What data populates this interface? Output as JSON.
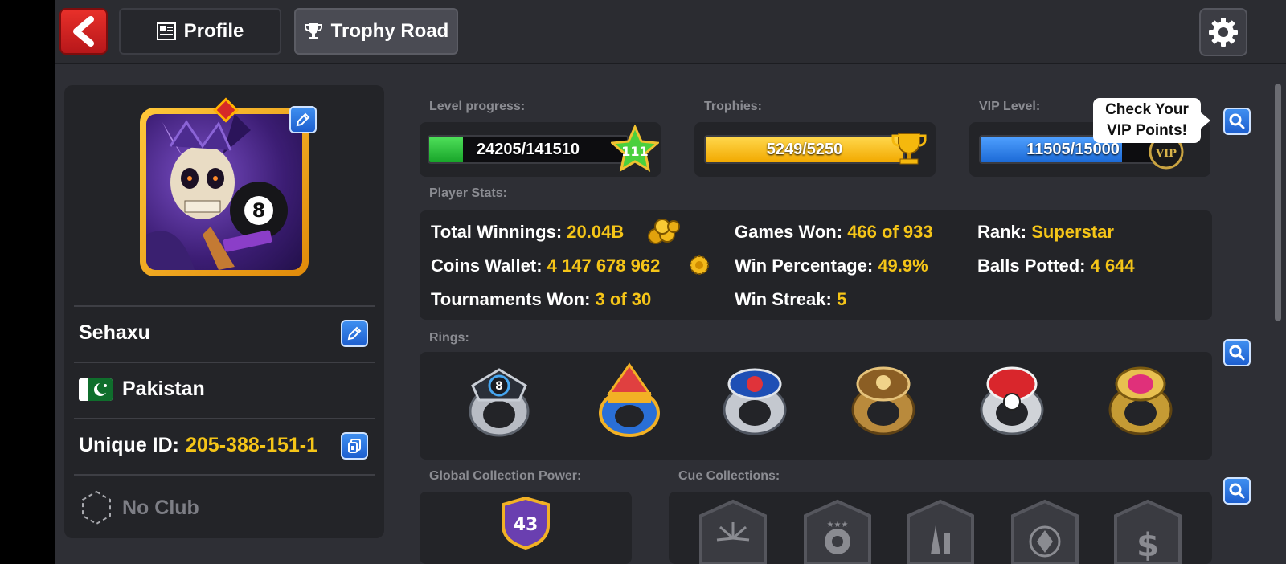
{
  "topbar": {
    "profile_tab": "Profile",
    "trophy_tab": "Trophy Road"
  },
  "player": {
    "name": "Sehaxu",
    "country": "Pakistan",
    "unique_id_label": "Unique ID:",
    "unique_id": "205-388-151-1",
    "club": "No Club"
  },
  "level": {
    "label": "Level progress:",
    "text": "24205/141510",
    "fraction": 0.171,
    "level": "111"
  },
  "trophies": {
    "label": "Trophies:",
    "text": "5249/5250",
    "fraction": 0.9998
  },
  "vip": {
    "label": "VIP Level:",
    "text": "11505/15000",
    "fraction": 0.767,
    "tooltip_line1": "Check Your",
    "tooltip_line2": "VIP Points!"
  },
  "stats": {
    "label": "Player Stats:",
    "total_winnings_label": "Total Winnings:",
    "total_winnings": "20.04B",
    "coins_wallet_label": "Coins Wallet:",
    "coins_wallet": "4 147 678 962",
    "tournaments_won_label": "Tournaments Won:",
    "tournaments_won": "3 of 30",
    "games_won_label": "Games Won:",
    "games_won": "466 of 933",
    "win_percentage_label": "Win Percentage:",
    "win_percentage": "49.9%",
    "win_streak_label": "Win Streak:",
    "win_streak": "5",
    "rank_label": "Rank:",
    "rank": "Superstar",
    "balls_potted_label": "Balls Potted:",
    "balls_potted": "4 644"
  },
  "rings": {
    "label": "Rings:",
    "items": [
      "master-ring",
      "legend-ring",
      "toronto-ring",
      "champion-ring",
      "las-vegas-ring",
      "venue-ring"
    ]
  },
  "collection": {
    "global_label": "Global Collection Power:",
    "power": "43",
    "cue_label": "Cue Collections:"
  },
  "colors": {
    "accent_yellow": "#f5c518",
    "xp_green": "#22c33a",
    "trophy_gold": "#f7b500",
    "vip_blue": "#2c86e8"
  }
}
